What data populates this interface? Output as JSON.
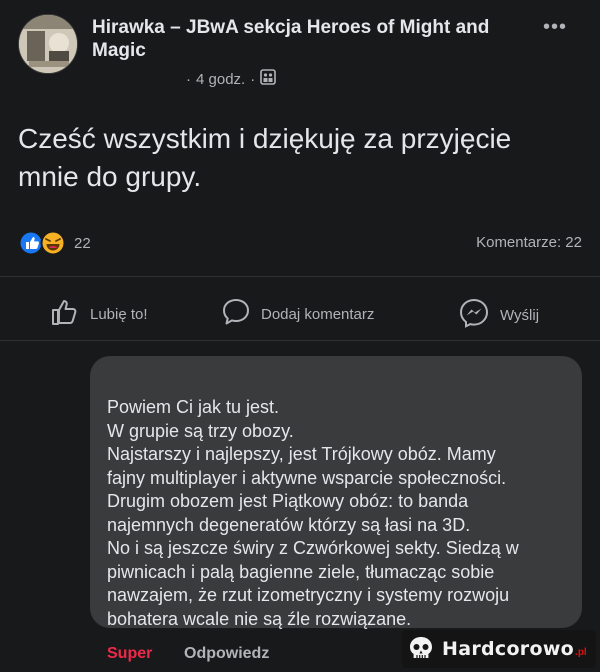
{
  "post": {
    "group_name": "Hirawka – JBwA sekcja Heroes of Might and Magic",
    "time": "4 godz.",
    "privacy_icon": "group-members-icon",
    "more_icon": "more-options-icon",
    "text": "Cześć wszystkim i dziękuję za przyjęcie mnie do grupy.",
    "reaction_count": "22",
    "reactions": [
      "like",
      "haha"
    ],
    "comments_label": "Komentarze: 22"
  },
  "actions": {
    "like": "Lubię to!",
    "comment": "Dodaj komentarz",
    "send": "Wyślij"
  },
  "comment": {
    "lines": [
      "Powiem Ci jak tu jest.",
      "W grupie są trzy obozy.",
      "Najstarszy i najlepszy, jest Trójkowy obóz. Mamy",
      "fajny multiplayer i aktywne wsparcie społeczności.",
      "Drugim obozem jest Piątkowy obóz: to banda",
      "najemnych degeneratów którzy są łasi na 3D.",
      "No i są jeszcze świry z Czwórkowej sekty. Siedzą w",
      "piwnicach i palą bagienne ziele, tłumacząc sobie",
      "nawzajem, że rzut izometryczny i systemy rozwoju",
      "bohatera wcale nie są źle rozwiązane."
    ],
    "reaction_label": "Super",
    "reply_label": "Odpowiedz"
  },
  "watermark": {
    "text": "Hardcorowo",
    "suffix": ".pl"
  },
  "colors": {
    "background": "#18191a",
    "bubble": "#3a3b3c",
    "super_red": "#f02849",
    "like_blue": "#1877f2",
    "haha_yellow": "#f7b125",
    "muted": "#b0b3b8"
  }
}
